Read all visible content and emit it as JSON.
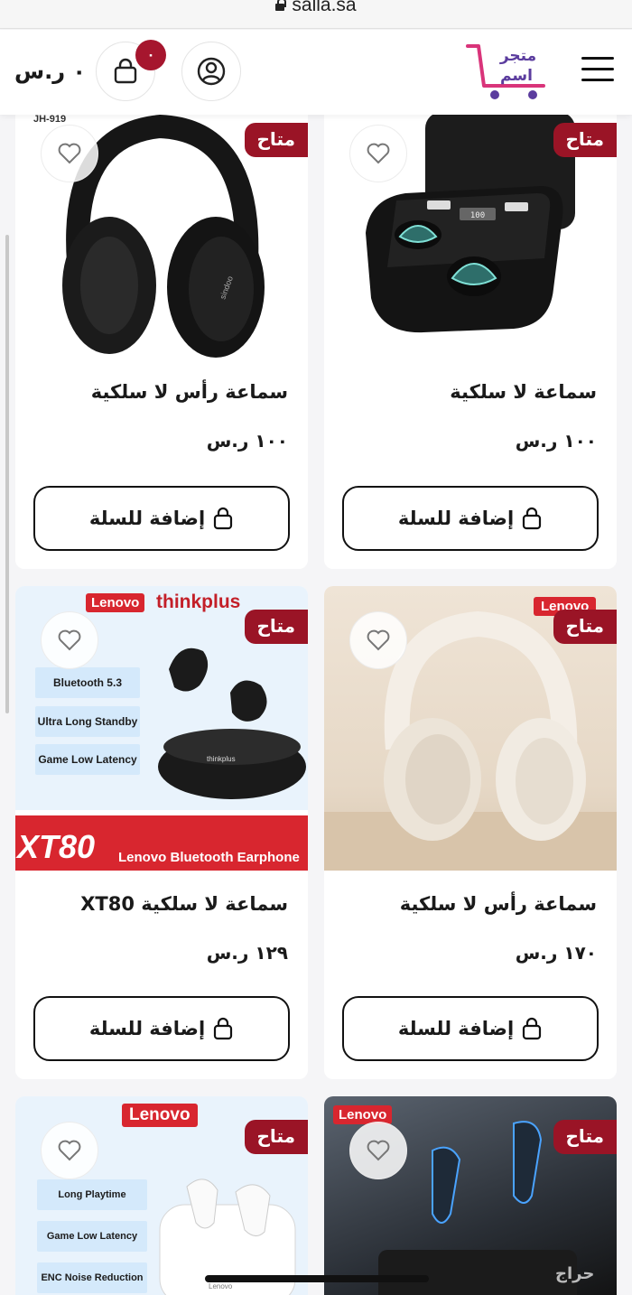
{
  "browser": {
    "url": "salla.sa"
  },
  "header": {
    "cart_total": "٠ ر.س",
    "cart_count": "٠",
    "logo_text": "متجر اسم"
  },
  "add_to_cart_label": "إضافة للسلة",
  "products": [
    {
      "name": "سماعة لا سلكية",
      "price": "١٠٠ ر.س",
      "status": "متاح"
    },
    {
      "name": "سماعة رأس لا سلكية",
      "price": "١٠٠ ر.س",
      "status": "متاح",
      "model_label": "JH-919",
      "brand_print": "sindoo"
    },
    {
      "name": "سماعة رأس لا سلكية",
      "price": "١٧٠ ر.س",
      "status": "متاح",
      "brand_label": "Lenovo"
    },
    {
      "name": "سماعة لا سلكية XT80",
      "price": "١٢٩ ر.س",
      "status": "متاح",
      "brand_label": "Lenovo",
      "sub_brand": "thinkplus",
      "features": [
        "Bluetooth 5.3",
        "Ultra Long Standby",
        "Game Low Latency"
      ],
      "banner_model": "XT80",
      "banner_text": "Lenovo Bluetooth Earphone",
      "case_print": "thinkplus"
    },
    {
      "name": "",
      "price": "",
      "status": "متاح",
      "brand_label": "Lenovo"
    },
    {
      "name": "",
      "price": "",
      "status": "متاح",
      "brand_label": "Lenovo",
      "features": [
        "Long Playtime",
        "Game Low Latency",
        "ENC Noise Reduction"
      ],
      "case_print": "Lenovo"
    }
  ],
  "watermark": "حراج",
  "colors": {
    "accent": "#9a1426",
    "badge": "#a6162e",
    "logo_purple": "#5b3c9e",
    "logo_pink": "#d9347a"
  }
}
